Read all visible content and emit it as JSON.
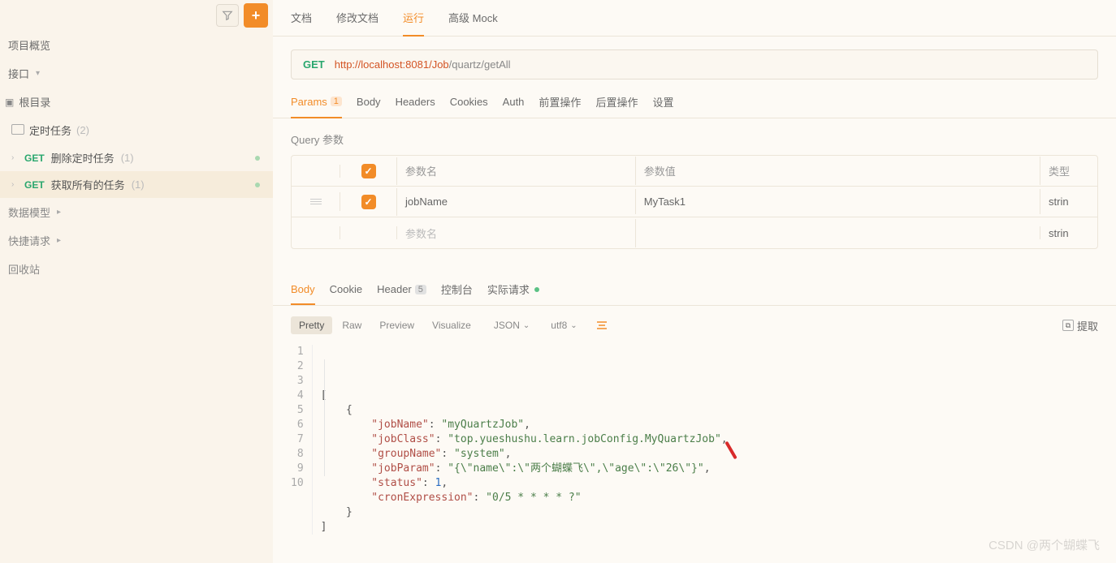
{
  "sidebar": {
    "overview": "项目概览",
    "api": "接口",
    "root": "根目录",
    "dataModel": "数据模型",
    "quickReq": "快捷请求",
    "recycle": "回收站",
    "folder": {
      "name": "定时任务",
      "count": "(2)"
    },
    "items": [
      {
        "method": "GET",
        "label": "删除定时任务",
        "count": "(1)"
      },
      {
        "method": "GET",
        "label": "获取所有的任务",
        "count": "(1)"
      }
    ]
  },
  "topTabs": [
    "文档",
    "修改文档",
    "运行",
    "高级 Mock"
  ],
  "activeTopTab": 2,
  "request": {
    "method": "GET",
    "urlHost": "http://localhost:8081/Job",
    "urlPath": "/quartz/getAll"
  },
  "subTabs": {
    "params": "Params",
    "paramsCount": "1",
    "body": "Body",
    "headers": "Headers",
    "cookies": "Cookies",
    "auth": "Auth",
    "pre": "前置操作",
    "post": "后置操作",
    "settings": "设置"
  },
  "query": {
    "title": "Query 参数",
    "headers": {
      "name": "参数名",
      "value": "参数值",
      "type": "类型"
    },
    "rows": [
      {
        "name": "jobName",
        "value": "MyTask1",
        "type": "strin"
      }
    ],
    "emptyRow": {
      "placeholder": "参数名",
      "type": "strin"
    }
  },
  "respTabs": {
    "body": "Body",
    "cookie": "Cookie",
    "header": "Header",
    "headerCount": "5",
    "console": "控制台",
    "actual": "实际请求"
  },
  "toolbar": {
    "pretty": "Pretty",
    "raw": "Raw",
    "preview": "Preview",
    "visualize": "Visualize",
    "format": "JSON",
    "encoding": "utf8",
    "extract": "提取"
  },
  "code": {
    "lines": [
      "[",
      "    {",
      "        \"jobName\": \"myQuartzJob\",",
      "        \"jobClass\": \"top.yueshushu.learn.jobConfig.MyQuartzJob\",",
      "        \"groupName\": \"system\",",
      "        \"jobParam\": \"{\\\"name\\\":\\\"两个蝴蝶飞\\\",\\\"age\\\":\\\"26\\\"}\",",
      "        \"status\": 1,",
      "        \"cronExpression\": \"0/5 * * * * ?\"",
      "    }",
      "]"
    ]
  },
  "watermark": "CSDN @两个蝴蝶飞"
}
